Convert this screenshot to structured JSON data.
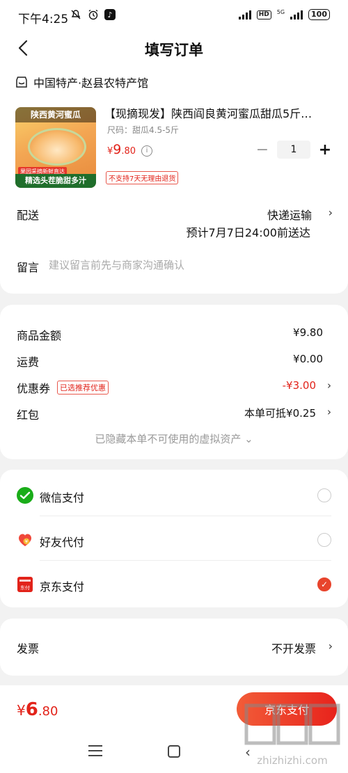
{
  "status_bar": {
    "time": "下午4:25",
    "network": "5G",
    "battery": "100"
  },
  "header": {
    "title": "填写订单"
  },
  "shop": {
    "name": "中国特产·赵县农特产馆"
  },
  "product": {
    "image_caption_top": "陕西黄河蜜瓜",
    "image_caption_mid": "果园采摘新鲜直达",
    "image_caption_bottom": "精选头茬脆甜多汁",
    "title": "【现摘现发】陕西阎良黄河蜜瓜甜瓜5斤…",
    "spec": "尺码：甜瓜4.5-5斤",
    "price_symbol": "¥",
    "price_int": "9",
    "price_dec": ".80",
    "quantity": "1",
    "return_policy": "不支持7天无理由退货"
  },
  "delivery": {
    "label": "配送",
    "method": "快递运输",
    "eta": "预计7月7日24:00前送达"
  },
  "note": {
    "label": "留言",
    "placeholder": "建议留言前先与商家沟通确认"
  },
  "fees": {
    "goods_label": "商品金额",
    "goods_value": "¥9.80",
    "shipping_label": "运费",
    "shipping_value": "¥0.00",
    "coupon_label": "优惠券",
    "coupon_badge": "已选推荐优惠",
    "coupon_value": "-¥3.00",
    "redpacket_label": "红包",
    "redpacket_value": "本单可抵¥0.25",
    "hidden_assets": "已隐藏本单不可使用的虚拟资产 ⌄"
  },
  "payment": {
    "options": [
      {
        "label": "微信支付",
        "selected": false
      },
      {
        "label": "好友代付",
        "selected": false
      },
      {
        "label": "京东支付",
        "selected": true
      }
    ]
  },
  "invoice": {
    "label": "发票",
    "value": "不开发票"
  },
  "bottom": {
    "total_symbol": "¥",
    "total_int": "6",
    "total_dec": ".80",
    "pay_button": "京东支付"
  },
  "colors": {
    "accent": "#e2231a",
    "button": "#e8231c",
    "wechat": "#1aad19"
  },
  "watermark": {
    "title": "值",
    "site": "zhizhizhi.com"
  }
}
